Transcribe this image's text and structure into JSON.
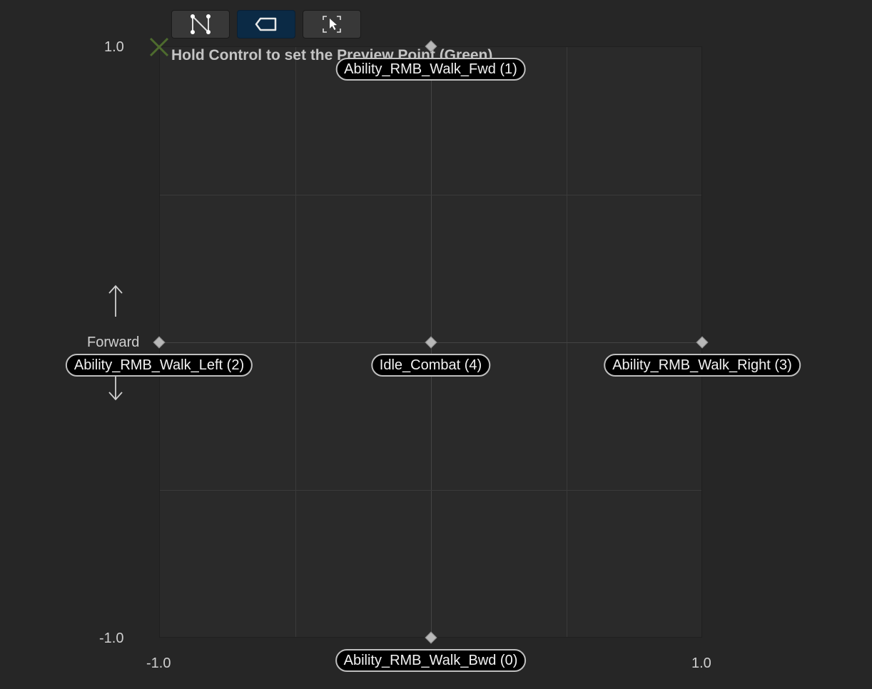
{
  "toolbar": {
    "buttons": [
      {
        "icon": "triangulation-icon",
        "active": false
      },
      {
        "icon": "label-tag-icon",
        "active": true
      },
      {
        "icon": "fit-view-icon",
        "active": false
      }
    ]
  },
  "hint": "Hold Control to set the Preview Point (Green)",
  "axes": {
    "y_max": "1.0",
    "y_min": "-1.0",
    "x_min": "-1.0",
    "x_max": "1.0",
    "y_name": "Forward"
  },
  "samples": [
    {
      "label": "Ability_RMB_Walk_Fwd (1)",
      "x": 0,
      "y": 1
    },
    {
      "label": "Ability_RMB_Walk_Left (2)",
      "x": -1,
      "y": 0
    },
    {
      "label": "Idle_Combat (4)",
      "x": 0,
      "y": 0
    },
    {
      "label": "Ability_RMB_Walk_Right (3)",
      "x": 1,
      "y": 0
    },
    {
      "label": "Ability_RMB_Walk_Bwd (0)",
      "x": 0,
      "y": -1
    }
  ],
  "preview_point": {
    "x": -1,
    "y": 1
  },
  "colors": {
    "accent": "#0b2a45",
    "preview": "#4d6b2e"
  }
}
